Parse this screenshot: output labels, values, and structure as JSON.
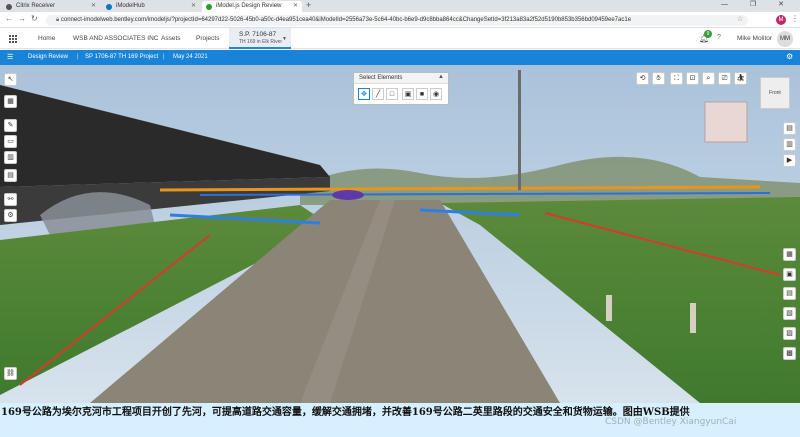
{
  "browser": {
    "tabs": [
      {
        "label": "Citrix Receiver",
        "color": "#555555"
      },
      {
        "label": "iModelHub",
        "color": "#0d77c3"
      },
      {
        "label": "iModel.js Design Review",
        "color": "#2a9d2a"
      }
    ],
    "new_tab": "+",
    "window_controls": "— ❐ ✕",
    "url": "connect-imodelweb.bentley.com/imodeljs/?projectId=64297d22-5026-45b0-a50c-d4ea951cea40&iModelId=2556a73e-5c64-40bc-b6e9-d9c8bba864cc&ChangeSetId=3f213a83a2f52d5190b853b356bd09459ee7ac1e",
    "avatar": "M"
  },
  "app_header": {
    "nav": [
      "Home",
      "WSB AND ASSOCIATES INC",
      "Assets",
      "Projects"
    ],
    "project_code": "S.P. 7106-87",
    "project_name": "TH 169 in Elk River",
    "notification_count": "9",
    "help": "?",
    "user_name": "Mike Molitor",
    "user_initials": "MM"
  },
  "breadcrumb": {
    "items": [
      "Design Review",
      "SP 1706-87 TH 169 Project",
      "May 24 2021"
    ]
  },
  "viewport": {
    "select_panel_title": "Select Elements",
    "cube_label": "Front"
  },
  "caption": "169号公路为埃尔克河市工程项目开创了先河，可提高道路交通容量，缓解交通拥堵，并改善169号公路二英里路段的交通安全和货物运输。图由WSB提供",
  "watermark": "CSDN @Bentley XiangyunCai"
}
